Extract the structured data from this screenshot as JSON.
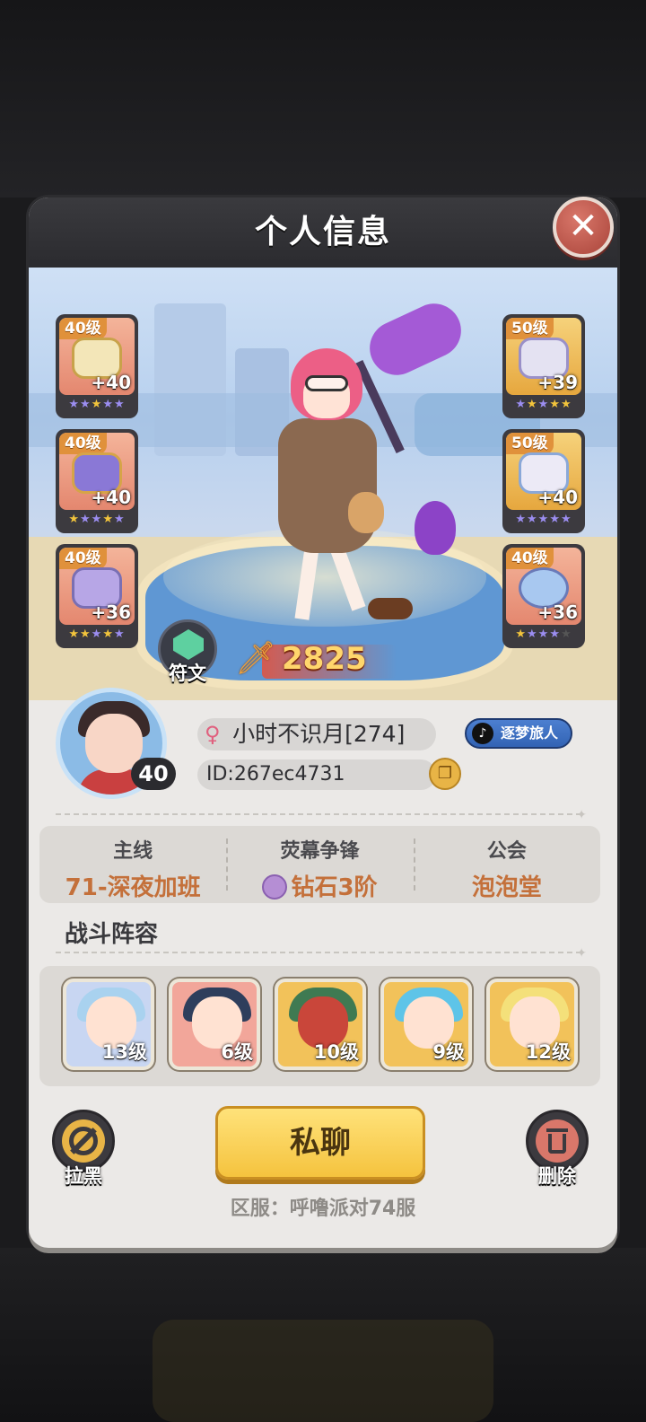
{
  "panel": {
    "title": "个人信息"
  },
  "equipment": [
    {
      "level": "40级",
      "plus": "+40",
      "stars": "★★★★★"
    },
    {
      "level": "40级",
      "plus": "+40",
      "stars": "★★★★★"
    },
    {
      "level": "40级",
      "plus": "+36",
      "stars": "★★★★★"
    },
    {
      "level": "50级",
      "plus": "+39",
      "stars": "★★★★★"
    },
    {
      "level": "50级",
      "plus": "+40",
      "stars": "★★★★★"
    },
    {
      "level": "40级",
      "plus": "+36",
      "stars": "★★★★★"
    }
  ],
  "rune": {
    "label": "符文",
    "icon": "green-gem-icon"
  },
  "power": {
    "value": "2825",
    "icon": "sword-icon"
  },
  "profile": {
    "level": "40",
    "gender_icon": "♀",
    "name": "小时不识月[274]",
    "badge": "逐梦旅人",
    "id": "ID:267ec4731"
  },
  "stats": [
    {
      "key": "主线",
      "value": "71-深夜加班"
    },
    {
      "key": "荧幕争锋",
      "value": "钻石3阶"
    },
    {
      "key": "公会",
      "value": "泡泡堂"
    }
  ],
  "team": {
    "title": "战斗阵容",
    "members": [
      {
        "level": "13级"
      },
      {
        "level": "6级"
      },
      {
        "level": "10级"
      },
      {
        "level": "9级"
      },
      {
        "level": "12级"
      }
    ]
  },
  "actions": {
    "chat": "私聊",
    "block": "拉黑",
    "delete": "删除"
  },
  "server": "区服：呼噜派对74服",
  "colors": {
    "accent": "#f5c33e",
    "stat_value": "#c4703a",
    "close": "#a9443a"
  }
}
